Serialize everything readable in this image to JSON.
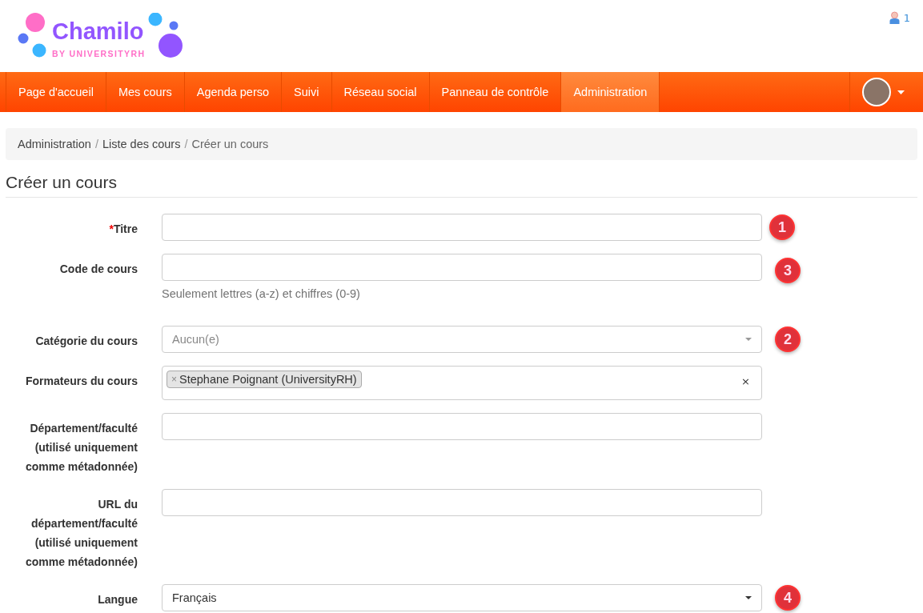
{
  "logo": {
    "name": "Chamilo",
    "tagline": "BY UNIVERSITYRH"
  },
  "user_count": "1",
  "nav": [
    {
      "label": "Page d'accueil",
      "selected": false
    },
    {
      "label": "Mes cours",
      "selected": false
    },
    {
      "label": "Agenda perso",
      "selected": false
    },
    {
      "label": "Suivi",
      "selected": false
    },
    {
      "label": "Réseau social",
      "selected": false
    },
    {
      "label": "Panneau de contrôle",
      "selected": false
    },
    {
      "label": "Administration",
      "selected": true
    }
  ],
  "breadcrumb": [
    "Administration",
    "Liste des cours",
    "Créer un cours"
  ],
  "breadcrumb_separator": "/",
  "required_mark": "*",
  "heading": "Créer un cours",
  "fields": [
    {
      "kind": "text",
      "label": "Titre",
      "required": true,
      "badge": "1"
    },
    {
      "kind": "text",
      "label": "Code de cours",
      "required": false,
      "badge": "3",
      "help": "Seulement lettres (a-z) et chiffres (0-9)"
    },
    {
      "kind": "select",
      "label": "Catégorie du cours",
      "required": false,
      "badge": "2",
      "placeholder": "Aucun(e)"
    },
    {
      "kind": "tags",
      "label": "Formateurs du cours",
      "required": false,
      "tags": [
        "Stephane Poignant (UniversityRH)"
      ],
      "clear": "×",
      "tag_remove": "×"
    },
    {
      "kind": "text",
      "label": "Département/faculté (utilisé uniquement comme métadonnée)",
      "required": false
    },
    {
      "kind": "text",
      "label": "URL du département/faculté (utilisé uniquement comme métadonnée)",
      "required": false
    },
    {
      "kind": "select",
      "label": "Langue",
      "required": false,
      "badge": "4",
      "value": "Français"
    }
  ]
}
